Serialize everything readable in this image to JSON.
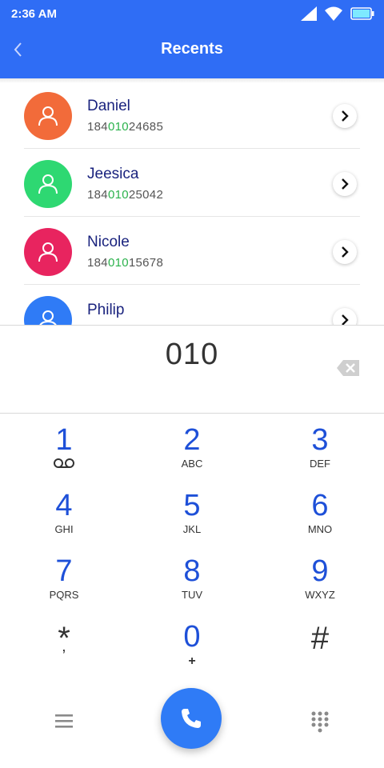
{
  "status_bar": {
    "time": "2:36 AM",
    "icons": [
      "signal-icon",
      "wifi-icon",
      "battery-icon"
    ]
  },
  "app_bar": {
    "title": "Recents",
    "back_icon": "back-chevron-icon"
  },
  "contacts": [
    {
      "name": "Daniel",
      "number_pre": "184",
      "number_match": "010",
      "number_post": "24685",
      "avatar_color": "#f26b3a"
    },
    {
      "name": "Jeesica",
      "number_pre": "184",
      "number_match": "010",
      "number_post": "25042",
      "avatar_color": "#2ed872"
    },
    {
      "name": "Nicole",
      "number_pre": "184",
      "number_match": "010",
      "number_post": "15678",
      "avatar_color": "#e8245f"
    },
    {
      "name": "Philip",
      "number_pre": "",
      "number_match": "",
      "number_post": "",
      "avatar_color": "#2f7bf6"
    }
  ],
  "dialer": {
    "input": "010",
    "backspace_icon": "backspace-icon"
  },
  "keypad": [
    {
      "digit": "1",
      "letters": ""
    },
    {
      "digit": "2",
      "letters": "ABC"
    },
    {
      "digit": "3",
      "letters": "DEF"
    },
    {
      "digit": "4",
      "letters": "GHI"
    },
    {
      "digit": "5",
      "letters": "JKL"
    },
    {
      "digit": "6",
      "letters": "MNO"
    },
    {
      "digit": "7",
      "letters": "PQRS"
    },
    {
      "digit": "8",
      "letters": "TUV"
    },
    {
      "digit": "9",
      "letters": "WXYZ"
    },
    {
      "digit": "*",
      "letters": "ʼ"
    },
    {
      "digit": "0",
      "letters": "+"
    },
    {
      "digit": "#",
      "letters": ""
    }
  ],
  "colors": {
    "primary": "#2f6df5",
    "digit": "#1e50d8",
    "match_highlight": "#2bb24c",
    "name": "#1a237e"
  }
}
